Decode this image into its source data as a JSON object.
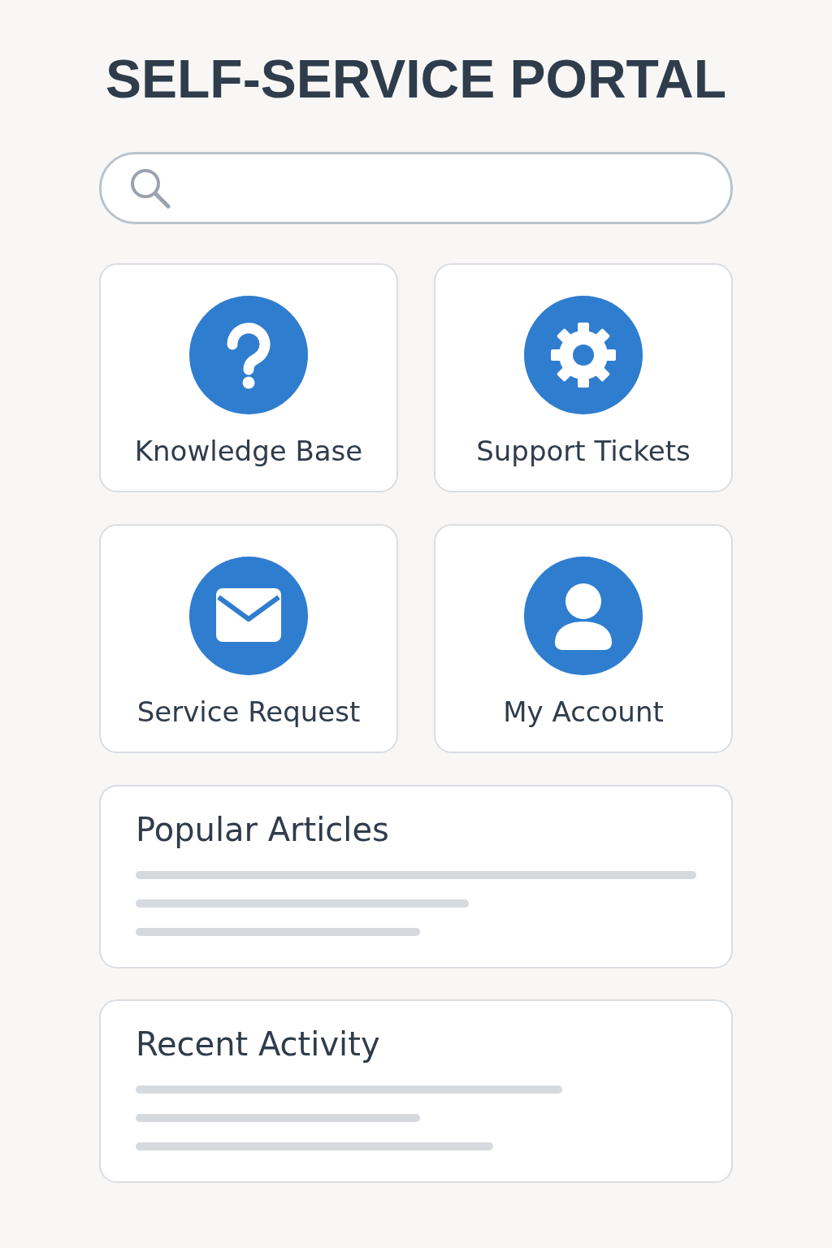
{
  "title": "SELF-SERVICE PORTAL",
  "tiles": [
    {
      "label": "Knowledge Base"
    },
    {
      "label": "Support Tickets"
    },
    {
      "label": "Service Request"
    },
    {
      "label": "My Account"
    }
  ],
  "panels": [
    {
      "title": "Popular Articles"
    },
    {
      "title": "Recent Activity"
    }
  ]
}
